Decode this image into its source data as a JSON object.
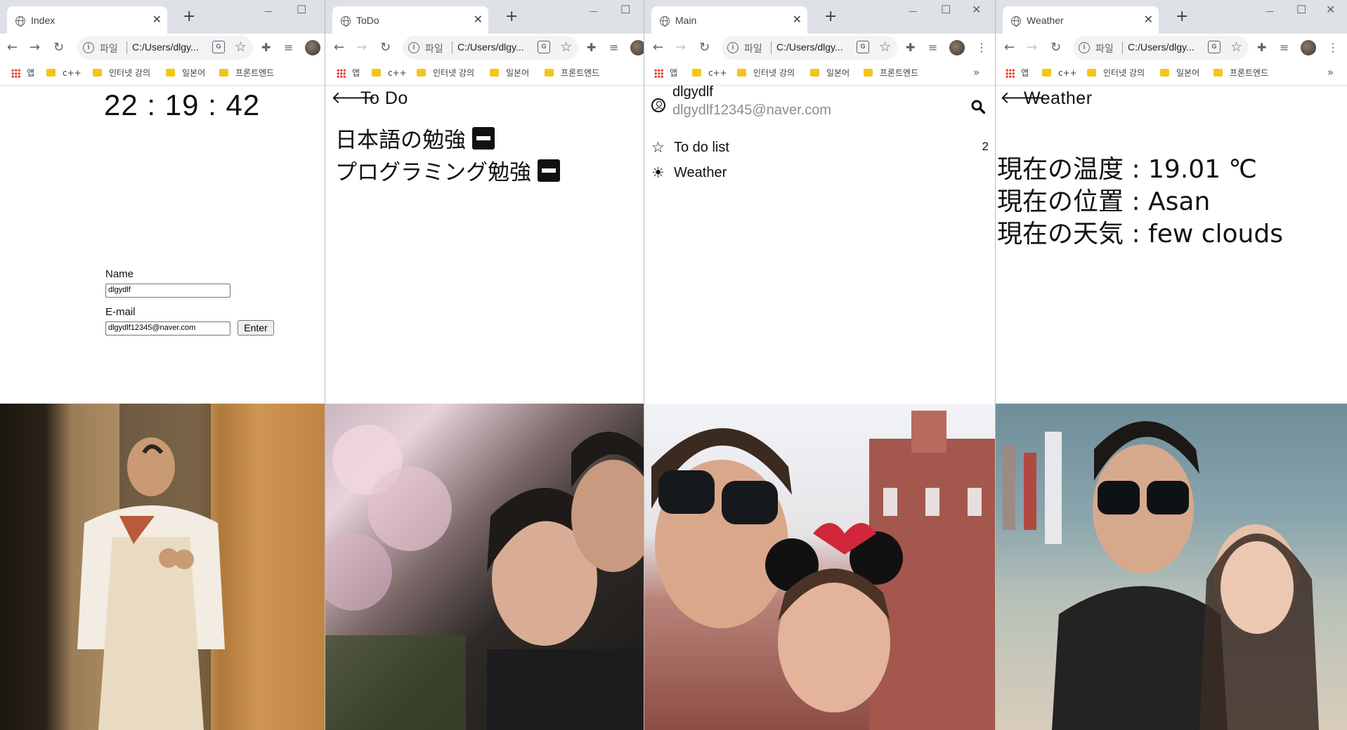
{
  "tabs": {
    "index": {
      "title": "Index",
      "close": "✕",
      "new": "+"
    },
    "todo": {
      "title": "ToDo",
      "close": "✕",
      "new": "+"
    },
    "main": {
      "title": "Main",
      "close": "✕",
      "new": "+"
    },
    "weather": {
      "title": "Weather",
      "close": "✕",
      "new": "+"
    }
  },
  "window_controls": {
    "minimize": "—",
    "maximize": "☐",
    "close": "✕"
  },
  "address_bar": {
    "scheme_label": "파일",
    "url": "C:/Users/dlgy..."
  },
  "bookmarks": [
    {
      "label": "앱"
    },
    {
      "label": "c++"
    },
    {
      "label": "인터넷 강의"
    },
    {
      "label": "일본어"
    },
    {
      "label": "프론트엔드"
    }
  ],
  "index_page": {
    "clock": "22 : 19 : 42",
    "name_label": "Name",
    "name_value": "dlgydlf",
    "email_label": "E-mail",
    "email_value": "dlgydlf12345@naver.com",
    "enter_label": "Enter"
  },
  "todo_page": {
    "title": "To Do",
    "items": [
      "日本語の勉強",
      "プログラミング勉強"
    ]
  },
  "main_page": {
    "username": "dlgydlf",
    "email": "dlgydlf12345@naver.com",
    "menu": [
      {
        "label": "To do list",
        "count": "2",
        "icon": "star-icon"
      },
      {
        "label": "Weather",
        "count": "",
        "icon": "sun-icon"
      }
    ]
  },
  "weather_page": {
    "title": "Weather",
    "lines": [
      "現在の温度 : 19.01 ℃",
      "現在の位置 : Asan",
      "現在の天気 : few clouds"
    ]
  },
  "colors": {
    "tabbar": "#dee1e6",
    "omnibox": "#f1f3f4",
    "folder": "#f5c518"
  }
}
